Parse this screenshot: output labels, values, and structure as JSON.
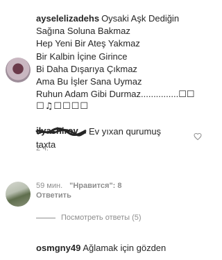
{
  "comment1": {
    "username": "ayselelizadehs",
    "lines": [
      "Oysaki Aşk Dediğin",
      "Sağına Soluna Bakmaz",
      "Hep Yeni Bir Ateş Yakmaz",
      "Bir Kalbin İçine Girince",
      "Bi Daha Dışarıya Çıkmaz",
      "Ama Bu İşler Sana Uymaz",
      "Ruhun Adam Gibi Durmaz...............☐☐",
      "☐♫☐☐☐☐"
    ],
    "time": "2 ч."
  },
  "comment2": {
    "username": "ilyashirov",
    "text_line1": "Ev yıxan qurumuş",
    "text_line2": "taxta",
    "time": "59 мин.",
    "likes": "\"Нравится\": 8",
    "reply": "Ответить"
  },
  "replies": {
    "label": "Посмотреть ответы (5)"
  },
  "comment3": {
    "username": "osmgny49",
    "text": "Ağlamak için gözden"
  },
  "icons": {
    "heart": "heart-icon"
  },
  "colors": {
    "text": "#262626",
    "meta": "#8e8e8e"
  }
}
